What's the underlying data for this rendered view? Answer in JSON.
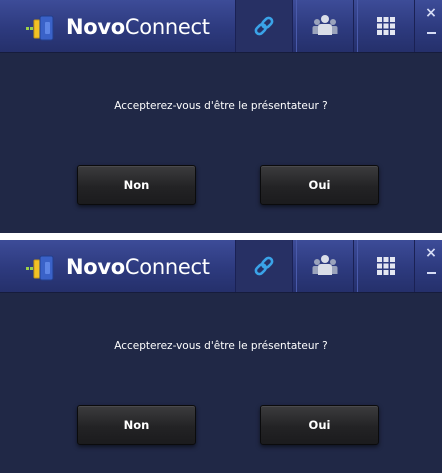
{
  "screens": [
    {
      "app_title": {
        "bold": "Novo",
        "regular": "Connect"
      },
      "prompt": "Accepterez-vous d'être le présentateur ?",
      "buttons": {
        "no": "Non",
        "yes": "Oui"
      },
      "window_controls": {
        "close": "×"
      }
    },
    {
      "app_title": {
        "bold": "Novo",
        "regular": "Connect"
      },
      "prompt": "Accepterez-vous d'être le présentateur ?",
      "buttons": {
        "no": "Non",
        "yes": "Oui"
      },
      "window_controls": {
        "close": "×"
      }
    }
  ],
  "tabs": [
    {
      "icon": "link-icon",
      "active": true
    },
    {
      "icon": "users-icon",
      "active": false
    },
    {
      "icon": "grid-icon",
      "active": false
    }
  ],
  "colors": {
    "background": "#202846",
    "titlebar": "#2d3a7e",
    "link_icon": "#3aa3e8",
    "button": "#232325",
    "text": "#ffffff"
  }
}
